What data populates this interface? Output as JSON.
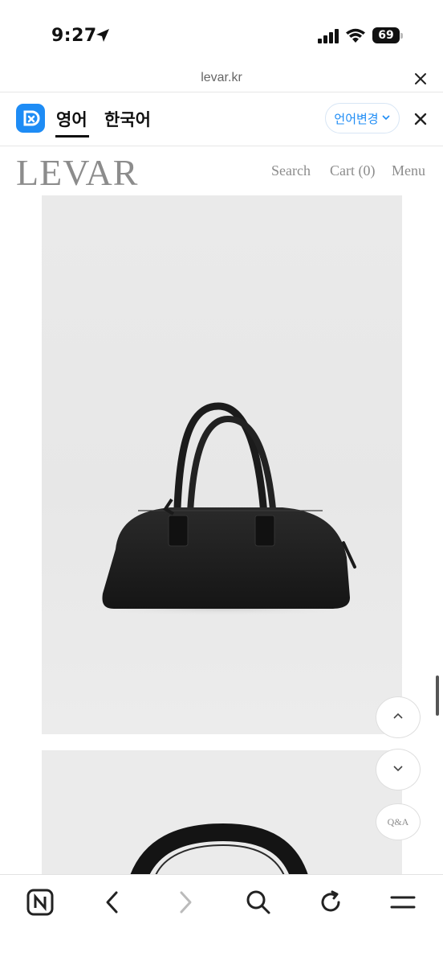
{
  "status_bar": {
    "time": "9:27",
    "battery": "69"
  },
  "browser": {
    "url": "levar.kr"
  },
  "translate_bar": {
    "source_lang": "영어",
    "target_lang": "한국어",
    "change_label": "언어변경"
  },
  "site": {
    "logo": "LEVAR",
    "nav": {
      "search": "Search",
      "cart": "Cart (0)",
      "menu": "Menu"
    }
  },
  "floating": {
    "qa_label": "Q&A"
  },
  "icons": {
    "status": [
      "location-arrow-icon",
      "signal-icon",
      "wifi-icon",
      "battery-icon"
    ],
    "toolbar": [
      "naver-n-icon",
      "back-icon",
      "forward-icon",
      "search-icon",
      "reload-icon",
      "menu-icon"
    ]
  },
  "colors": {
    "accent": "#1e8cf5",
    "site_text": "#8c8c8c",
    "photo_bg": "#ebebeb"
  }
}
